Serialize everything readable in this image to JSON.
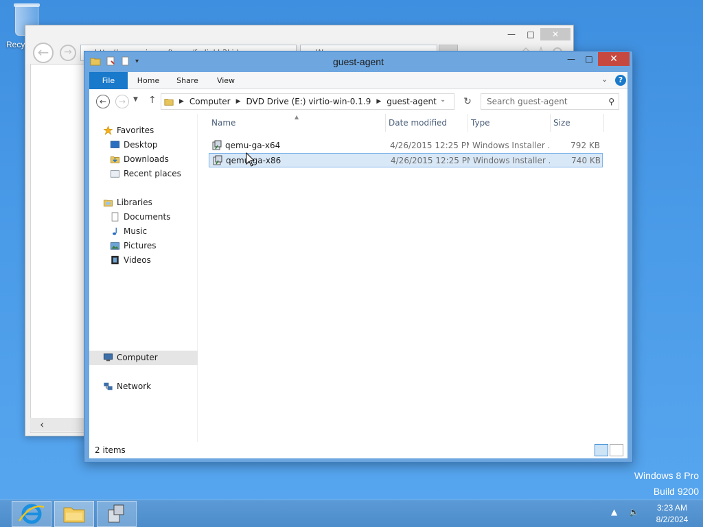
{
  "desktop": {
    "recycle_bin_label": "Recy",
    "watermark_line1": "Windows 8 Pro",
    "watermark_line2": "Build 9200",
    "accent": "#4a9be8"
  },
  "browser_window": {
    "address_text": "http://www.microsoft.com/fedial.h2kid...",
    "tab_text": "W...",
    "icons": [
      "back-arrow-icon",
      "forward-arrow-icon",
      "home-icon",
      "favorites-star-icon",
      "gear-icon"
    ]
  },
  "explorer": {
    "title": "guest-agent",
    "ribbon_tabs": [
      {
        "label": "File"
      },
      {
        "label": "Home"
      },
      {
        "label": "Share"
      },
      {
        "label": "View"
      }
    ],
    "breadcrumb": [
      "Computer",
      "DVD Drive (E:) virtio-win-0.1.9",
      "guest-agent"
    ],
    "search_placeholder": "Search guest-agent",
    "nav": {
      "favorites": {
        "label": "Favorites",
        "items": [
          {
            "label": "Desktop",
            "icon": "desktop-icon"
          },
          {
            "label": "Downloads",
            "icon": "downloads-icon"
          },
          {
            "label": "Recent places",
            "icon": "recent-places-icon"
          }
        ]
      },
      "libraries": {
        "label": "Libraries",
        "items": [
          {
            "label": "Documents",
            "icon": "documents-icon"
          },
          {
            "label": "Music",
            "icon": "music-icon"
          },
          {
            "label": "Pictures",
            "icon": "pictures-icon"
          },
          {
            "label": "Videos",
            "icon": "videos-icon"
          }
        ]
      },
      "computer": {
        "label": "Computer"
      },
      "network": {
        "label": "Network"
      }
    },
    "columns": {
      "name": "Name",
      "date": "Date modified",
      "type": "Type",
      "size": "Size"
    },
    "files": [
      {
        "name": "qemu-ga-x64",
        "date": "4/26/2015 12:25 PM",
        "type": "Windows Installer ...",
        "size": "792 KB",
        "selected": false
      },
      {
        "name": "qemu-ga-x86",
        "date": "4/26/2015 12:25 PM",
        "type": "Windows Installer ...",
        "size": "740 KB",
        "selected": true
      }
    ],
    "status": "2 items"
  },
  "taskbar": {
    "apps": [
      "internet-explorer-icon",
      "file-explorer-icon",
      "installer-app-icon"
    ],
    "time": "3:23 AM",
    "date": "8/2/2024"
  }
}
